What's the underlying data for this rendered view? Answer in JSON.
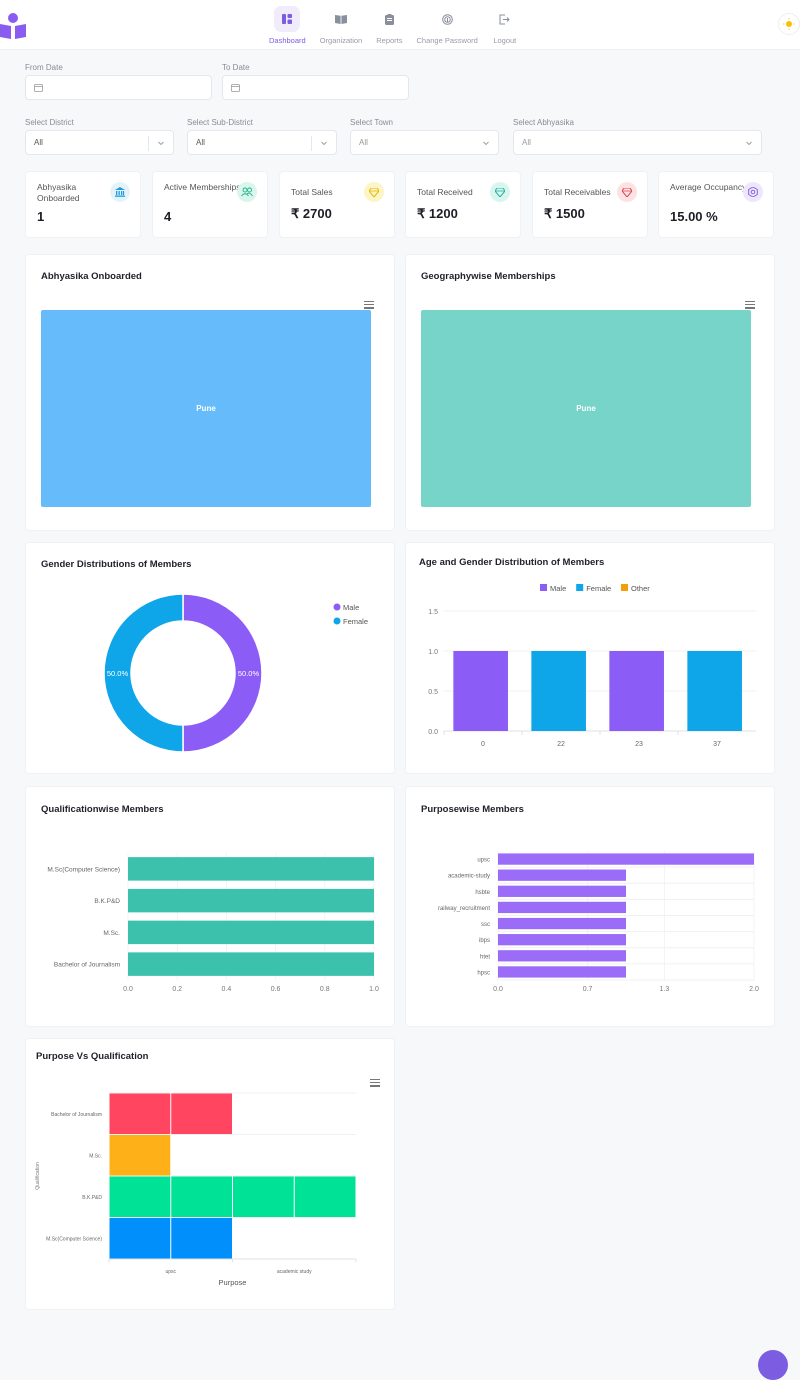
{
  "header": {
    "logo_icon": "reader-book-icon",
    "nav": [
      {
        "label": "Dashboard",
        "icon": "dashboard-icon",
        "active": true
      },
      {
        "label": "Organization",
        "icon": "book-icon",
        "active": false
      },
      {
        "label": "Reports",
        "icon": "clipboard-icon",
        "active": false
      },
      {
        "label": "Change Password",
        "icon": "fingerprint-icon",
        "active": false
      },
      {
        "label": "Logout",
        "icon": "logout-icon",
        "active": false
      }
    ],
    "theme_icon": "sun-icon"
  },
  "filters": {
    "from_date": {
      "label": "From Date",
      "value": ""
    },
    "to_date": {
      "label": "To Date",
      "value": ""
    },
    "district": {
      "label": "Select District",
      "value": "All"
    },
    "sub_district": {
      "label": "Select Sub-District",
      "value": "All"
    },
    "town": {
      "label": "Select Town",
      "value": "All"
    },
    "abhyasika": {
      "label": "Select Abhyasika",
      "value": "All"
    }
  },
  "stats": [
    {
      "title": "Abhyasika Onboarded",
      "value": "1",
      "icon": "bank-icon",
      "color": "#1e9ad6",
      "bg": "#e3f2fb"
    },
    {
      "title": "Active Memberships",
      "value": "4",
      "icon": "users-icon",
      "color": "#1fb38a",
      "bg": "#d9f5ec"
    },
    {
      "title": "Total Sales",
      "value": "₹ 2700",
      "icon": "diamond-icon",
      "color": "#e6b800",
      "bg": "#fcf5c8"
    },
    {
      "title": "Total Received",
      "value": "₹ 1200",
      "icon": "diamond-icon",
      "color": "#1fb3a0",
      "bg": "#d9f5f0"
    },
    {
      "title": "Total Receivables",
      "value": "₹ 1500",
      "icon": "diamond-icon",
      "color": "#e0474c",
      "bg": "#fde2e3"
    },
    {
      "title": "Average Occupancy",
      "value": "15.00 %",
      "icon": "hexagon-icon",
      "color": "#8a63e0",
      "bg": "#eee6fb"
    }
  ],
  "chart_data": [
    {
      "id": "abhyasika_onboarded",
      "type": "treemap",
      "title": "Abhyasika Onboarded",
      "items": [
        {
          "label": "Pune",
          "value": 1
        }
      ],
      "color": "#66bbfa"
    },
    {
      "id": "geography_memberships",
      "type": "treemap",
      "title": "Geographywise Memberships",
      "items": [
        {
          "label": "Pune",
          "value": 4
        }
      ],
      "color": "#76d4c9"
    },
    {
      "id": "gender_distribution",
      "type": "pie",
      "title": "Gender Distributions of Members",
      "labels": [
        "Male",
        "Female"
      ],
      "values": [
        50.0,
        50.0
      ],
      "value_labels": [
        "50.0%",
        "50.0%"
      ],
      "colors": [
        "#8b5cf6",
        "#0ea5e9"
      ],
      "legend": "right"
    },
    {
      "id": "age_gender",
      "type": "bar",
      "title": "Age and Gender Distribution of Members",
      "categories": [
        "0",
        "22",
        "23",
        "37"
      ],
      "series": [
        {
          "name": "Male",
          "values": [
            1,
            0,
            1,
            0
          ],
          "color": "#8b5cf6"
        },
        {
          "name": "Female",
          "values": [
            0,
            1,
            0,
            1
          ],
          "color": "#0ea5e9"
        },
        {
          "name": "Other",
          "values": [
            0,
            0,
            0,
            0
          ],
          "color": "#f59e0b"
        }
      ],
      "bar_colors": [
        "#8b5cf6",
        "#0ea5e9",
        "#8b5cf6",
        "#0ea5e9"
      ],
      "ylim": [
        0,
        1.5
      ],
      "yticks": [
        "0.0",
        "0.5",
        "1.0",
        "1.5"
      ],
      "legend": "top"
    },
    {
      "id": "qualification_members",
      "type": "bar",
      "orientation": "horizontal",
      "title": "Qualificationwise Members",
      "categories": [
        "M.Sc(Computer Science)",
        "B.K.P&D",
        "M.Sc.",
        "Bachelor of Journalism"
      ],
      "values": [
        1,
        1,
        1,
        1
      ],
      "xlim": [
        0,
        1
      ],
      "xticks": [
        "0.0",
        "0.2",
        "0.4",
        "0.6",
        "0.8",
        "1.0"
      ],
      "color": "#3cc2ac"
    },
    {
      "id": "purpose_members",
      "type": "bar",
      "orientation": "horizontal",
      "title": "Purposewise Members",
      "categories": [
        "upsc",
        "academic-study",
        "hsbte",
        "railway_recruitment",
        "ssc",
        "ibps",
        "htet",
        "hpsc"
      ],
      "values": [
        2,
        1,
        1,
        1,
        1,
        1,
        1,
        1
      ],
      "xlim": [
        0,
        2
      ],
      "xticks": [
        "0.0",
        "0.7",
        "1.3",
        "2.0"
      ],
      "color": "#9b6cf7"
    },
    {
      "id": "purpose_vs_qualification",
      "type": "heatmap",
      "title": "Purpose Vs Qualification",
      "xlabel": "Purpose",
      "ylabel": "Qualification",
      "x_ticks": [
        "upsc",
        "academic study"
      ],
      "rows": [
        {
          "label": "Bachelor of Journalism",
          "cells": 2,
          "color": "#ff4560"
        },
        {
          "label": "M.Sc.",
          "cells": 1,
          "color": "#feb019"
        },
        {
          "label": "B.K.P&D",
          "cells": 4,
          "color": "#00e396"
        },
        {
          "label": "M.Sc(Computer Science)",
          "cells": 2,
          "color": "#008ffb"
        }
      ]
    }
  ]
}
